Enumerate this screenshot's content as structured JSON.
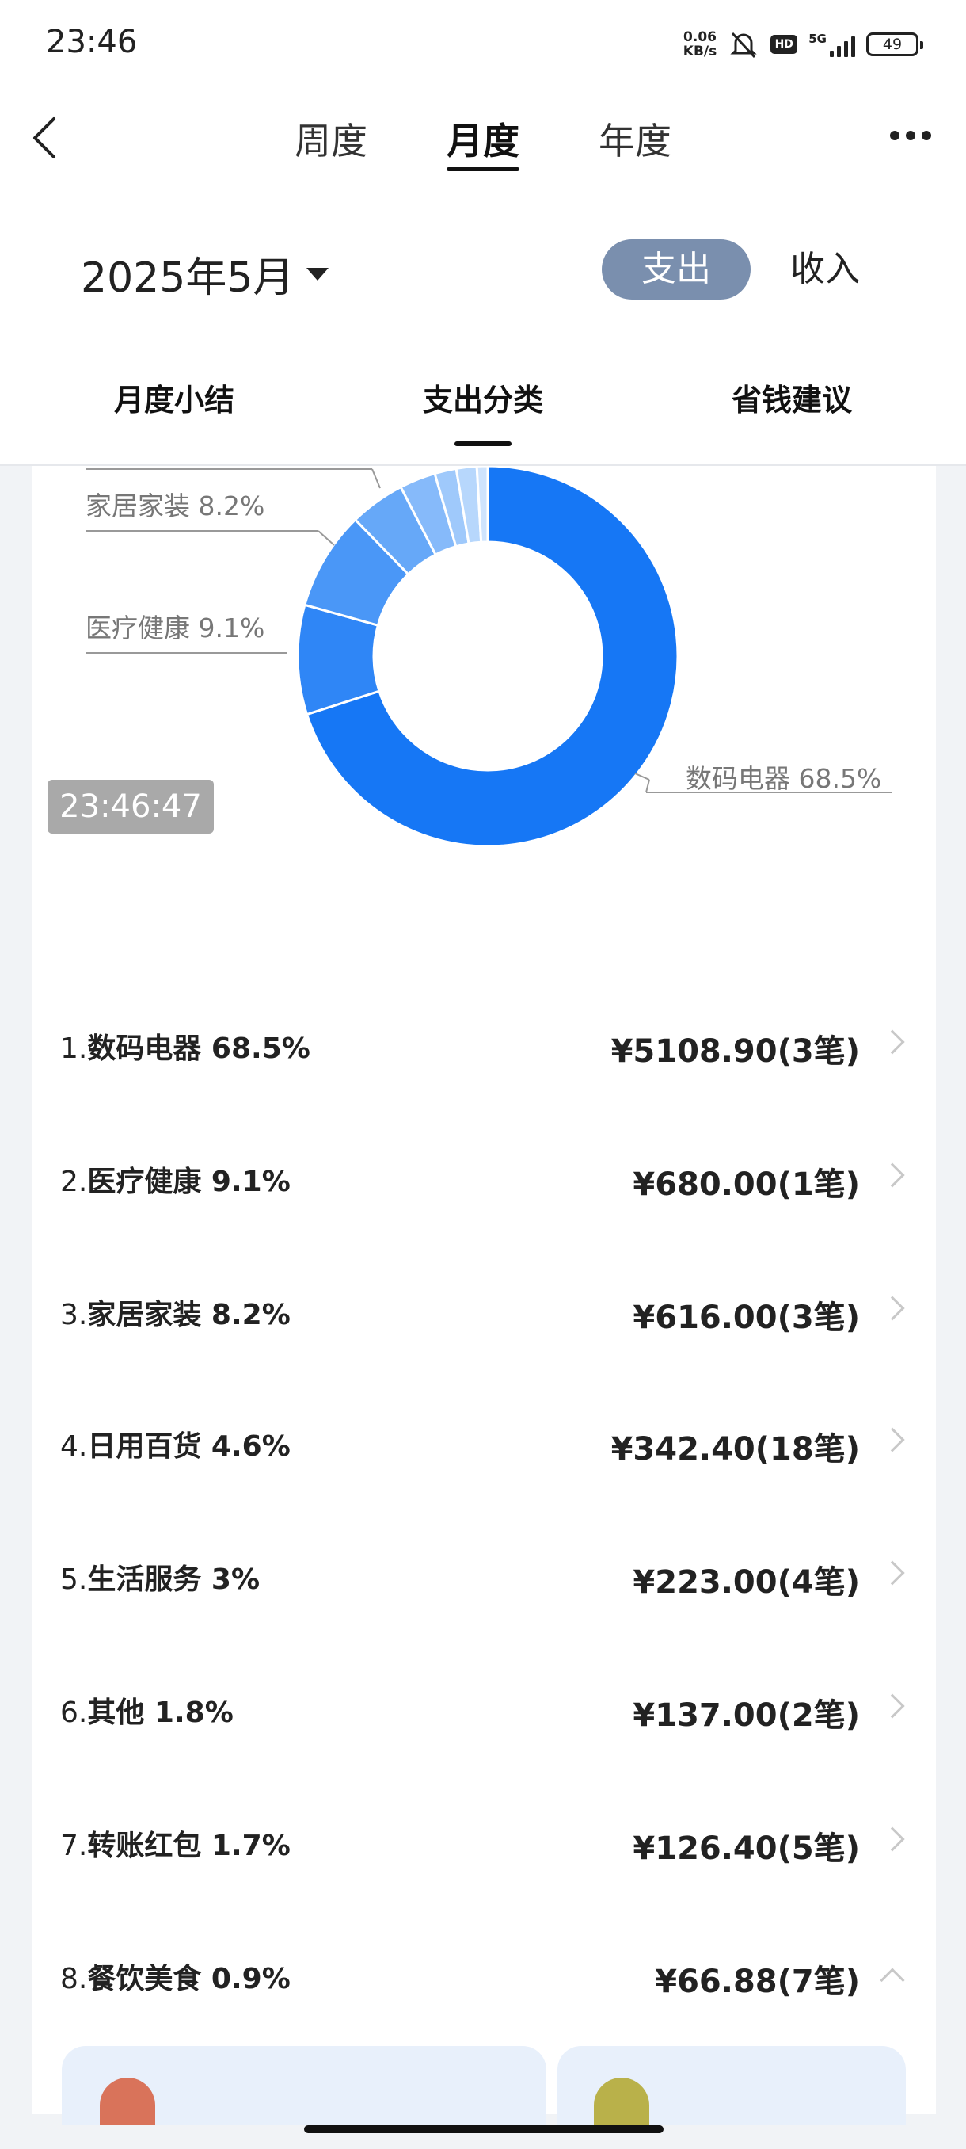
{
  "status_bar": {
    "time": "23:46",
    "net_speed_value": "0.06",
    "net_speed_unit": "KB/s",
    "hd_label": "HD",
    "network": "5G",
    "battery": "49"
  },
  "nav": {
    "tabs": [
      {
        "label": "周度"
      },
      {
        "label": "月度"
      },
      {
        "label": "年度"
      }
    ],
    "active_tab": "月度"
  },
  "filter": {
    "month": "2025年5月",
    "toggle_expense": "支出",
    "toggle_income": "收入",
    "active_toggle": "支出"
  },
  "sub_tabs": [
    {
      "label": "月度小结"
    },
    {
      "label": "支出分类"
    },
    {
      "label": "省钱建议"
    }
  ],
  "chart_data": {
    "type": "pie",
    "categories": [
      "数码电器",
      "医疗健康",
      "家居家装",
      "日用百货",
      "生活服务",
      "其他",
      "转账红包",
      "餐饮美食"
    ],
    "values": [
      68.5,
      9.1,
      8.2,
      4.6,
      3,
      1.8,
      1.7,
      0.9
    ],
    "colors": [
      "#1677f5",
      "#2f86f6",
      "#4a97f7",
      "#66a8f8",
      "#86bafa",
      "#9fc9fb",
      "#b7d7fc",
      "#cfe4fd"
    ],
    "callouts": [
      {
        "label": "家居家装 8.2%"
      },
      {
        "label": "医疗健康 9.1%"
      },
      {
        "label": "数码电器 68.5%"
      }
    ]
  },
  "timestamp": "23:46:47",
  "categories": [
    {
      "index": "1.",
      "name": "数码电器",
      "percent": "68.5%",
      "amount": "¥5108.90(3笔)"
    },
    {
      "index": "2.",
      "name": "医疗健康",
      "percent": "9.1%",
      "amount": "¥680.00(1笔)"
    },
    {
      "index": "3.",
      "name": "家居家装",
      "percent": "8.2%",
      "amount": "¥616.00(3笔)"
    },
    {
      "index": "4.",
      "name": "日用百货",
      "percent": "4.6%",
      "amount": "¥342.40(18笔)"
    },
    {
      "index": "5.",
      "name": "生活服务",
      "percent": "3%",
      "amount": "¥223.00(4笔)"
    },
    {
      "index": "6.",
      "name": "其他",
      "percent": "1.8%",
      "amount": "¥137.00(2笔)"
    },
    {
      "index": "7.",
      "name": "转账红包",
      "percent": "1.7%",
      "amount": "¥126.40(5笔)"
    },
    {
      "index": "8.",
      "name": "餐饮美食",
      "percent": "0.9%",
      "amount": "¥66.88(7笔)"
    }
  ]
}
